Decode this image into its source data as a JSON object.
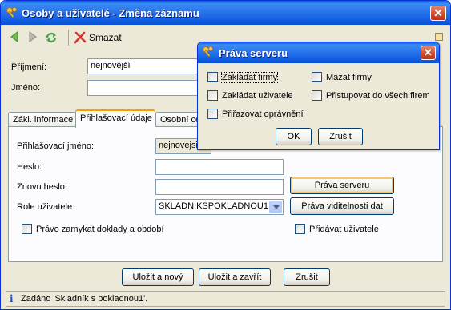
{
  "window": {
    "title": "Osoby a uživatelé - Změna záznamu",
    "close_symbol": "✕"
  },
  "toolbar": {
    "back_icon": "arrow-left-icon",
    "forward_icon": "arrow-right-icon",
    "refresh_icon": "refresh-icon",
    "delete_icon": "delete-x-icon",
    "delete_label": "Smazat"
  },
  "form": {
    "surname_label": "Příjmení:",
    "surname_value": "nejnovější",
    "name_label": "Jméno:",
    "name_value": ""
  },
  "tabs": [
    {
      "label": "Zákl. informace"
    },
    {
      "label": "Přihlašovací údaje"
    },
    {
      "label": "Osobní centrum"
    }
  ],
  "login_tab": {
    "login_name_label": "Přihlašovací jméno:",
    "login_name_value": "nejnovejsi",
    "password_label": "Heslo:",
    "password_value": "",
    "password_again_label": "Znovu heslo:",
    "password_again_value": "",
    "role_label": "Role uživatele:",
    "role_value": "SKLADNIKSPOKLADNOU1...",
    "server_rights_button": "Práva serveru",
    "data_visibility_button": "Práva viditelnosti dat",
    "lock_documents_label": "Právo zamykat doklady a období",
    "add_users_label": "Přidávat uživatele"
  },
  "footer": {
    "save_new": "Uložit a nový",
    "save_close": "Uložit a zavřít",
    "cancel": "Zrušit"
  },
  "status": {
    "icon": "info-icon",
    "text": "Zadáno 'Skladník s pokladnou1'."
  },
  "dialog": {
    "title": "Práva serveru",
    "close_symbol": "✕",
    "options": [
      {
        "label": "Zakládat firmy",
        "checked": false
      },
      {
        "label": "Mazat firmy",
        "checked": false
      },
      {
        "label": "Zakládat uživatele",
        "checked": false
      },
      {
        "label": "Přistupovat do všech firem",
        "checked": false
      },
      {
        "label": "Přiřazovat oprávnění",
        "checked": false
      }
    ],
    "ok": "OK",
    "cancel": "Zrušit"
  },
  "colors": {
    "titlebar": "#0a5ddc",
    "window_bg": "#ece9d8",
    "close_red": "#cf4a2a",
    "focus_orange": "#f7c46c"
  }
}
